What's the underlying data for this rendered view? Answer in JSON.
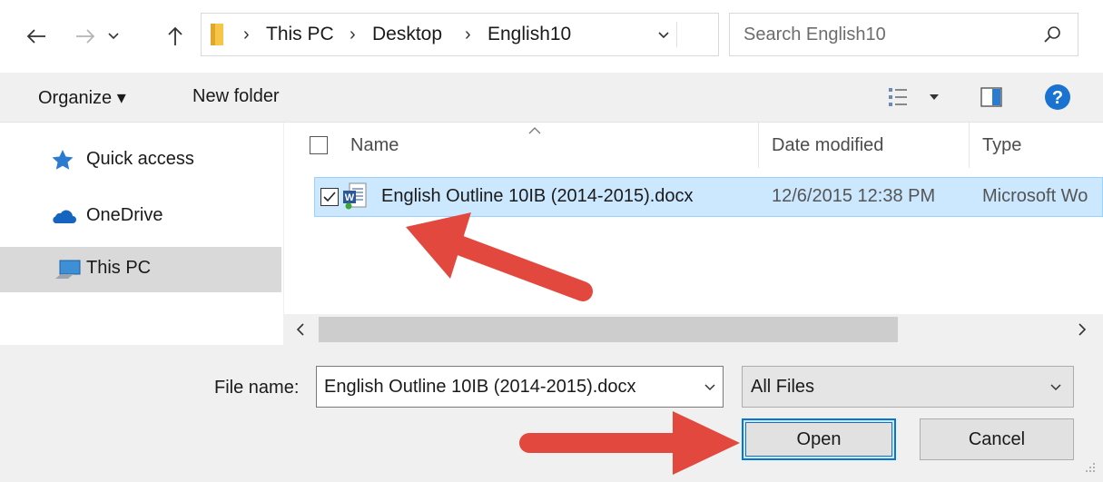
{
  "address_bar": {
    "breadcrumbs": [
      "This PC",
      "Desktop",
      "English10"
    ]
  },
  "search": {
    "placeholder": "Search English10"
  },
  "toolbar": {
    "organize_label": "Organize ▾",
    "new_folder_label": "New folder"
  },
  "nav_pane": {
    "items": [
      {
        "label": "Quick access",
        "icon": "star-icon"
      },
      {
        "label": "OneDrive",
        "icon": "cloud-icon"
      },
      {
        "label": "This PC",
        "icon": "computer-icon",
        "selected": true
      }
    ]
  },
  "file_list": {
    "columns": [
      "Name",
      "Date modified",
      "Type"
    ],
    "files": [
      {
        "name": "English Outline 10IB (2014-2015).docx",
        "date_modified": "12/6/2015 12:38 PM",
        "type": "Microsoft Wo",
        "icon": "word-document-icon",
        "selected": true,
        "checked": true
      }
    ]
  },
  "bottom": {
    "file_name_label": "File name:",
    "file_name_value": "English Outline 10IB (2014-2015).docx",
    "file_type_value": "All Files",
    "open_label": "Open",
    "cancel_label": "Cancel"
  },
  "colors": {
    "selection_bg": "#cce8ff",
    "selection_border": "#99d1ff",
    "accent": "#0078d7",
    "annotation_arrow": "#e2483d"
  }
}
